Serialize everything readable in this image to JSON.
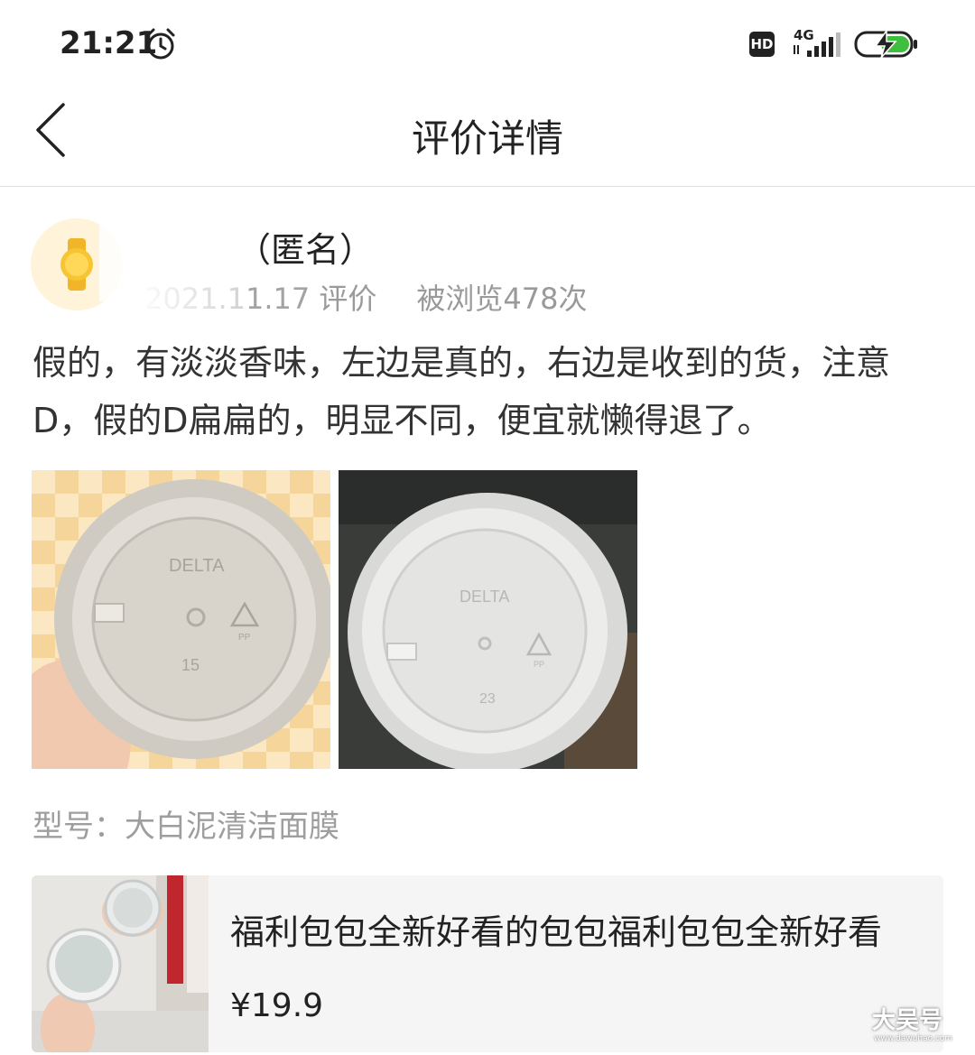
{
  "status_bar": {
    "time": "21:21",
    "hd_badge": "HD",
    "network": "4G",
    "icons": [
      "alarm-clock-icon",
      "signal-icon",
      "battery-charging-icon"
    ]
  },
  "nav": {
    "title": "评价详情",
    "back_icon": "chevron-left-icon"
  },
  "review": {
    "user_name_suffix": "（匿名）",
    "date": "2021.11.17",
    "date_suffix": " 评价",
    "views": "被浏览478次",
    "content": "假的，有淡淡香味，左边是真的，右边是收到的货，注意D，假的D扁扁的，明显不同，便宜就懒得退了。",
    "photos": [
      {
        "lid_brand": "DELTA",
        "lid_number": "15",
        "recycle": "PP"
      },
      {
        "lid_brand": "DELTA",
        "lid_number": "23",
        "recycle": "PP"
      }
    ],
    "model": "型号：大白泥清洁面膜"
  },
  "product": {
    "title": "福利包包全新好看的包包福利包包全新好看",
    "price": "¥19.9"
  },
  "watermark": {
    "text": "大吴号",
    "sub": "www.dawuhao.com"
  },
  "colors": {
    "text_primary": "#222222",
    "text_secondary": "#9a9a9a",
    "card_bg": "#f5f5f5",
    "divider": "#e3e3e3",
    "battery_green": "#3fbf3f",
    "avatar_yellow": "#f6c531"
  }
}
